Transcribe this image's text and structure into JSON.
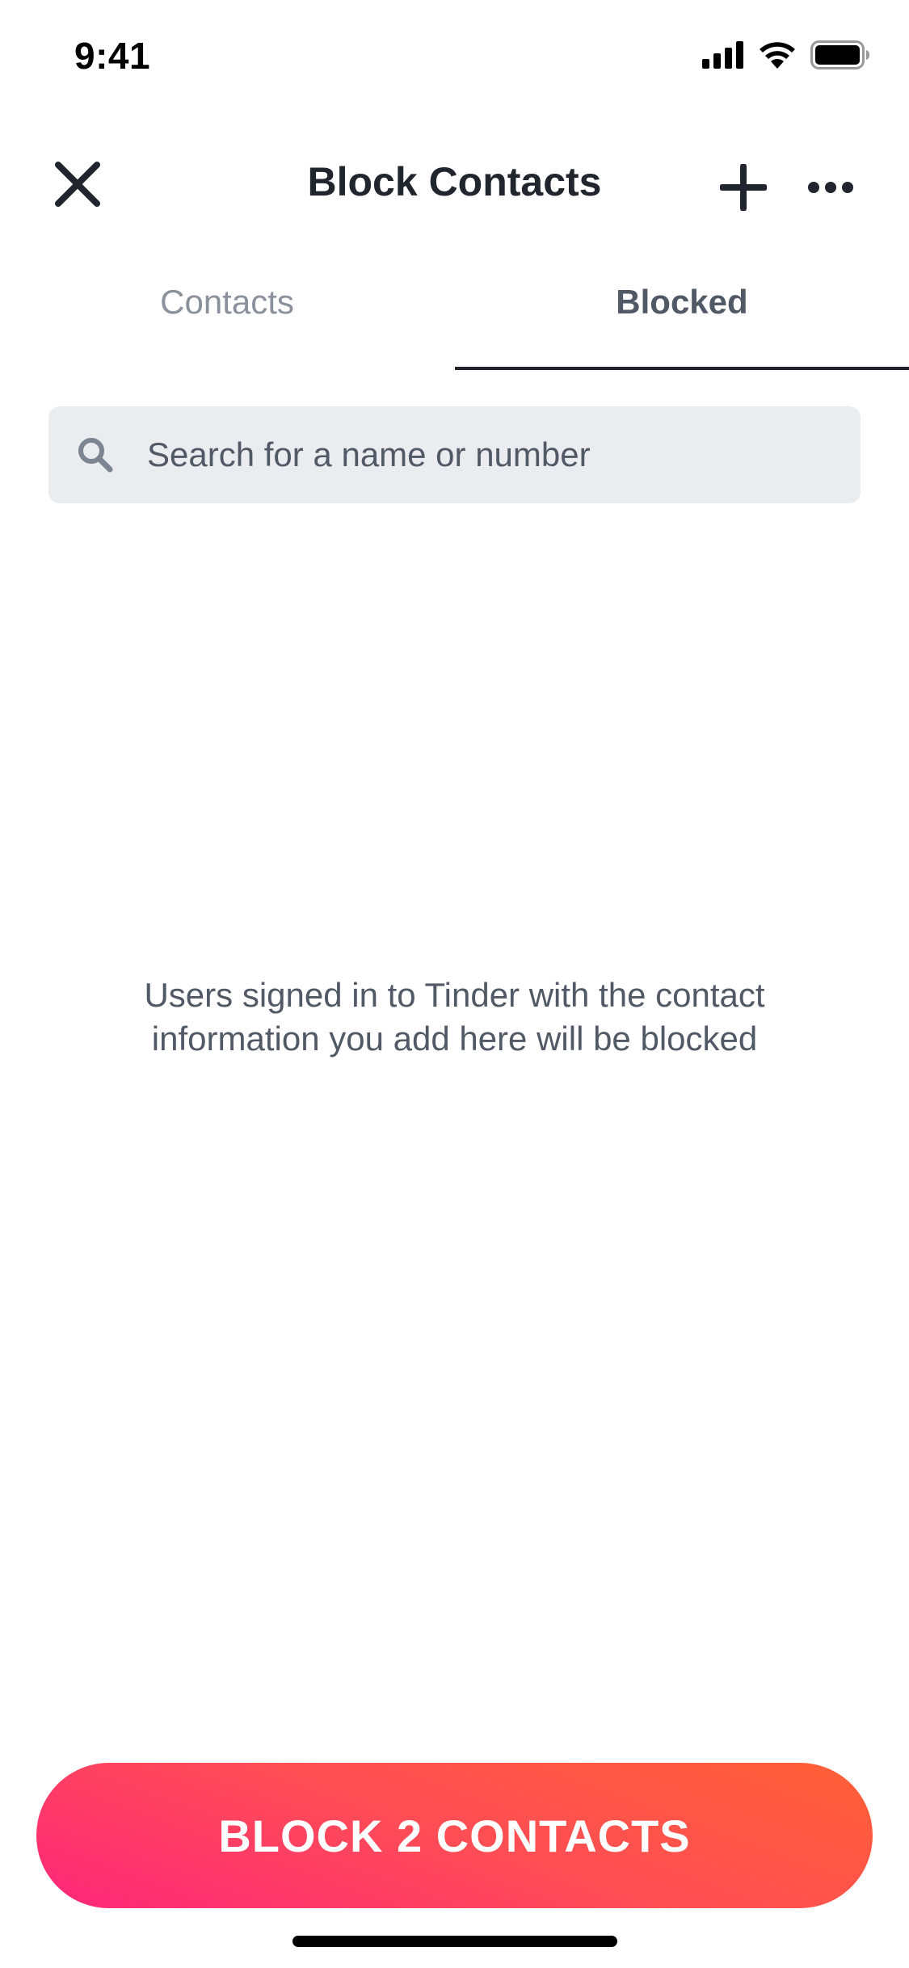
{
  "status_bar": {
    "time": "9:41",
    "icons": [
      "cellular-signal-icon",
      "wifi-icon",
      "battery-icon"
    ]
  },
  "nav": {
    "title": "Block Contacts",
    "icons": {
      "close": "close-icon",
      "add": "plus-icon",
      "more": "more-horizontal-icon"
    }
  },
  "tabs": [
    {
      "label": "Contacts",
      "active": false
    },
    {
      "label": "Blocked",
      "active": true
    }
  ],
  "search": {
    "placeholder": "Search for a name or number",
    "value": "",
    "icon": "search-icon"
  },
  "empty_state": {
    "message": "Users signed in to Tinder with the contact information you add here will be blocked"
  },
  "primary_action": {
    "label": "BLOCK 2 CONTACTS"
  },
  "colors": {
    "accent_gradient_start": "#fd267a",
    "accent_gradient_end": "#ff6036",
    "text_primary": "#21262e",
    "text_secondary": "#505965",
    "tab_inactive": "#8a919c",
    "search_bg": "#eaecef"
  }
}
